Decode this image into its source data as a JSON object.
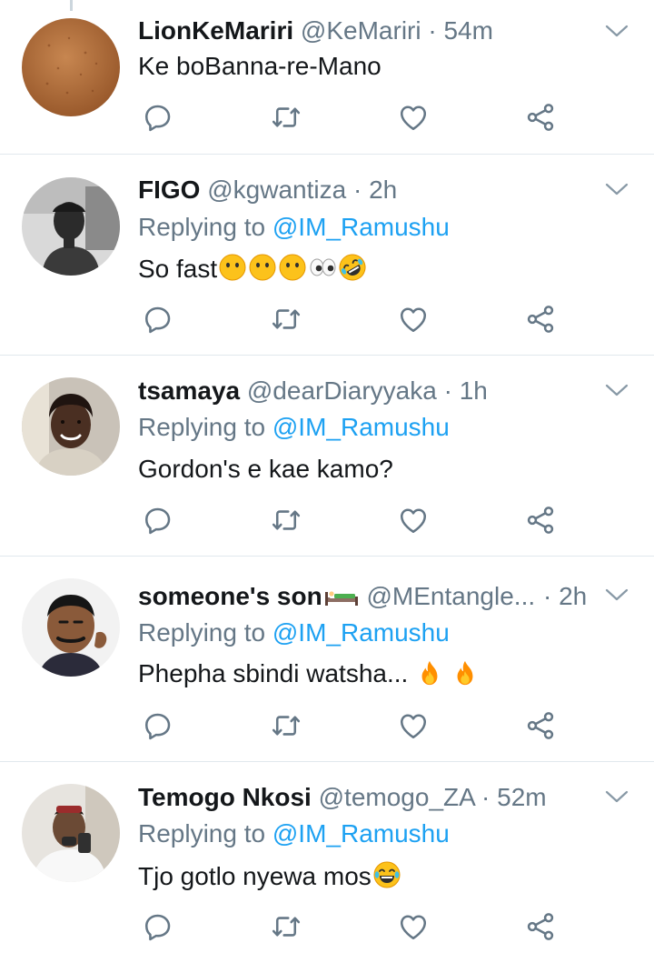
{
  "colors": {
    "link": "#1da1f2",
    "secondary_text": "#657786",
    "primary_text": "#14171a",
    "divider": "#e1e8ed"
  },
  "tweets": [
    {
      "name": "LionKeMariri",
      "handle": "@KeMariri",
      "dot": "·",
      "time": "54m",
      "reply_prefix": "",
      "reply_mention": "",
      "text": "Ke boBanna-re-Mano",
      "emojis": []
    },
    {
      "name": "FIGO",
      "handle": "@kgwantiza",
      "dot": "·",
      "time": "2h",
      "reply_prefix": "Replying to",
      "reply_mention": "@IM_Ramushu",
      "text": "So fast",
      "emojis": [
        "no-mouth-face",
        "no-mouth-face",
        "no-mouth-face",
        "eyes",
        "rolling-laughing-face"
      ]
    },
    {
      "name": "tsamaya",
      "handle": "@dearDiaryyaka",
      "dot": "·",
      "time": "1h",
      "reply_prefix": "Replying to",
      "reply_mention": "@IM_Ramushu",
      "text": "Gordon's e kae kamo?",
      "emojis": []
    },
    {
      "name": "someone's son",
      "handle": "@MEntangle...",
      "dot": "·",
      "time": "2h",
      "reply_prefix": "Replying to",
      "reply_mention": "@IM_Ramushu",
      "text": "Phepha sbindi watsha...",
      "emojis": [
        "fire",
        "fire"
      ],
      "name_emoji": "bed"
    },
    {
      "name": "Temogo Nkosi",
      "handle": "@temogo_ZA",
      "dot": "·",
      "time": "52m",
      "reply_prefix": "Replying to",
      "reply_mention": "@IM_Ramushu",
      "text": "Tjo gotlo nyewa mos",
      "emojis": [
        "tears-of-joy-face"
      ]
    }
  ],
  "icons": {
    "reply": "reply-icon",
    "retweet": "retweet-icon",
    "like": "like-icon",
    "share": "share-icon",
    "more": "chevron-down-icon"
  }
}
